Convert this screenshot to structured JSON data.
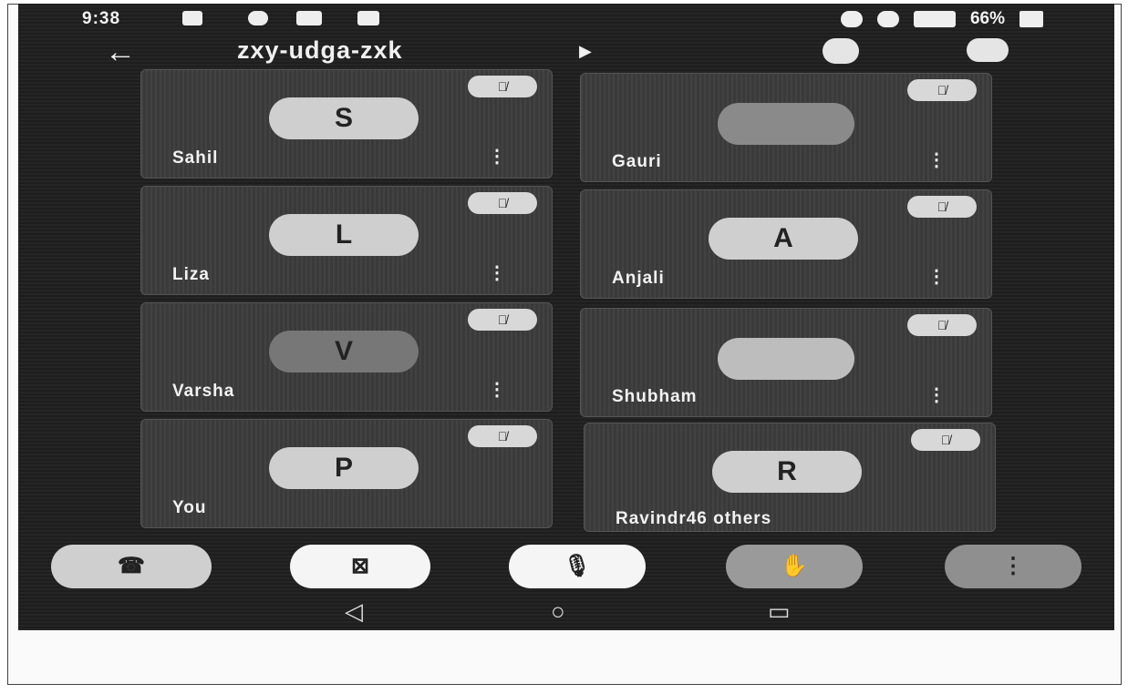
{
  "status_bar": {
    "time": "9:38",
    "battery": "66%",
    "left_icons": [
      "video-icon",
      "assistant-icon",
      "app-icon",
      "mail-icon"
    ],
    "right_icons": [
      "alarm-icon",
      "hotspot-icon",
      "signal-icon",
      "battery-icon"
    ]
  },
  "header": {
    "back_glyph": "←",
    "meeting_code": "zxy-udga-zxk",
    "expand_glyph": "▶"
  },
  "participants": [
    {
      "name": "Sahil",
      "initial": "S",
      "has_photo": false,
      "muted": true,
      "more_glyph": "⋮"
    },
    {
      "name": "Gauri",
      "initial": "",
      "has_photo": true,
      "muted": true,
      "more_glyph": "⋮"
    },
    {
      "name": "Liza",
      "initial": "L",
      "has_photo": false,
      "muted": true,
      "more_glyph": "⋮"
    },
    {
      "name": "Anjali",
      "initial": "A",
      "has_photo": false,
      "muted": true,
      "more_glyph": "⋮"
    },
    {
      "name": "Varsha",
      "initial": "V",
      "has_photo": false,
      "muted": true,
      "more_glyph": "⋮"
    },
    {
      "name": "Shubham",
      "initial": "",
      "has_photo": true,
      "muted": true,
      "more_glyph": "⋮"
    },
    {
      "name": "You",
      "initial": "P",
      "has_photo": false,
      "muted": true,
      "more_glyph": ""
    },
    {
      "name": "Ravindr46 others",
      "initial": "R",
      "has_photo": false,
      "muted": true,
      "more_glyph": ""
    }
  ],
  "controls": {
    "end_call_glyph": "☎",
    "camera_off_glyph": "⊠",
    "mic_off_glyph": "🎙",
    "raise_hand_glyph": "✋",
    "more_glyph": "⋮"
  },
  "nav": {
    "back_glyph": "◁",
    "home_glyph": "○",
    "recents_glyph": "▭"
  },
  "colors": {
    "screen_bg": "#1e1e1e",
    "tile_bg": "#3a3a3a",
    "pill_bg": "#cfcfcf",
    "active_btn": "#f5f5f5"
  }
}
